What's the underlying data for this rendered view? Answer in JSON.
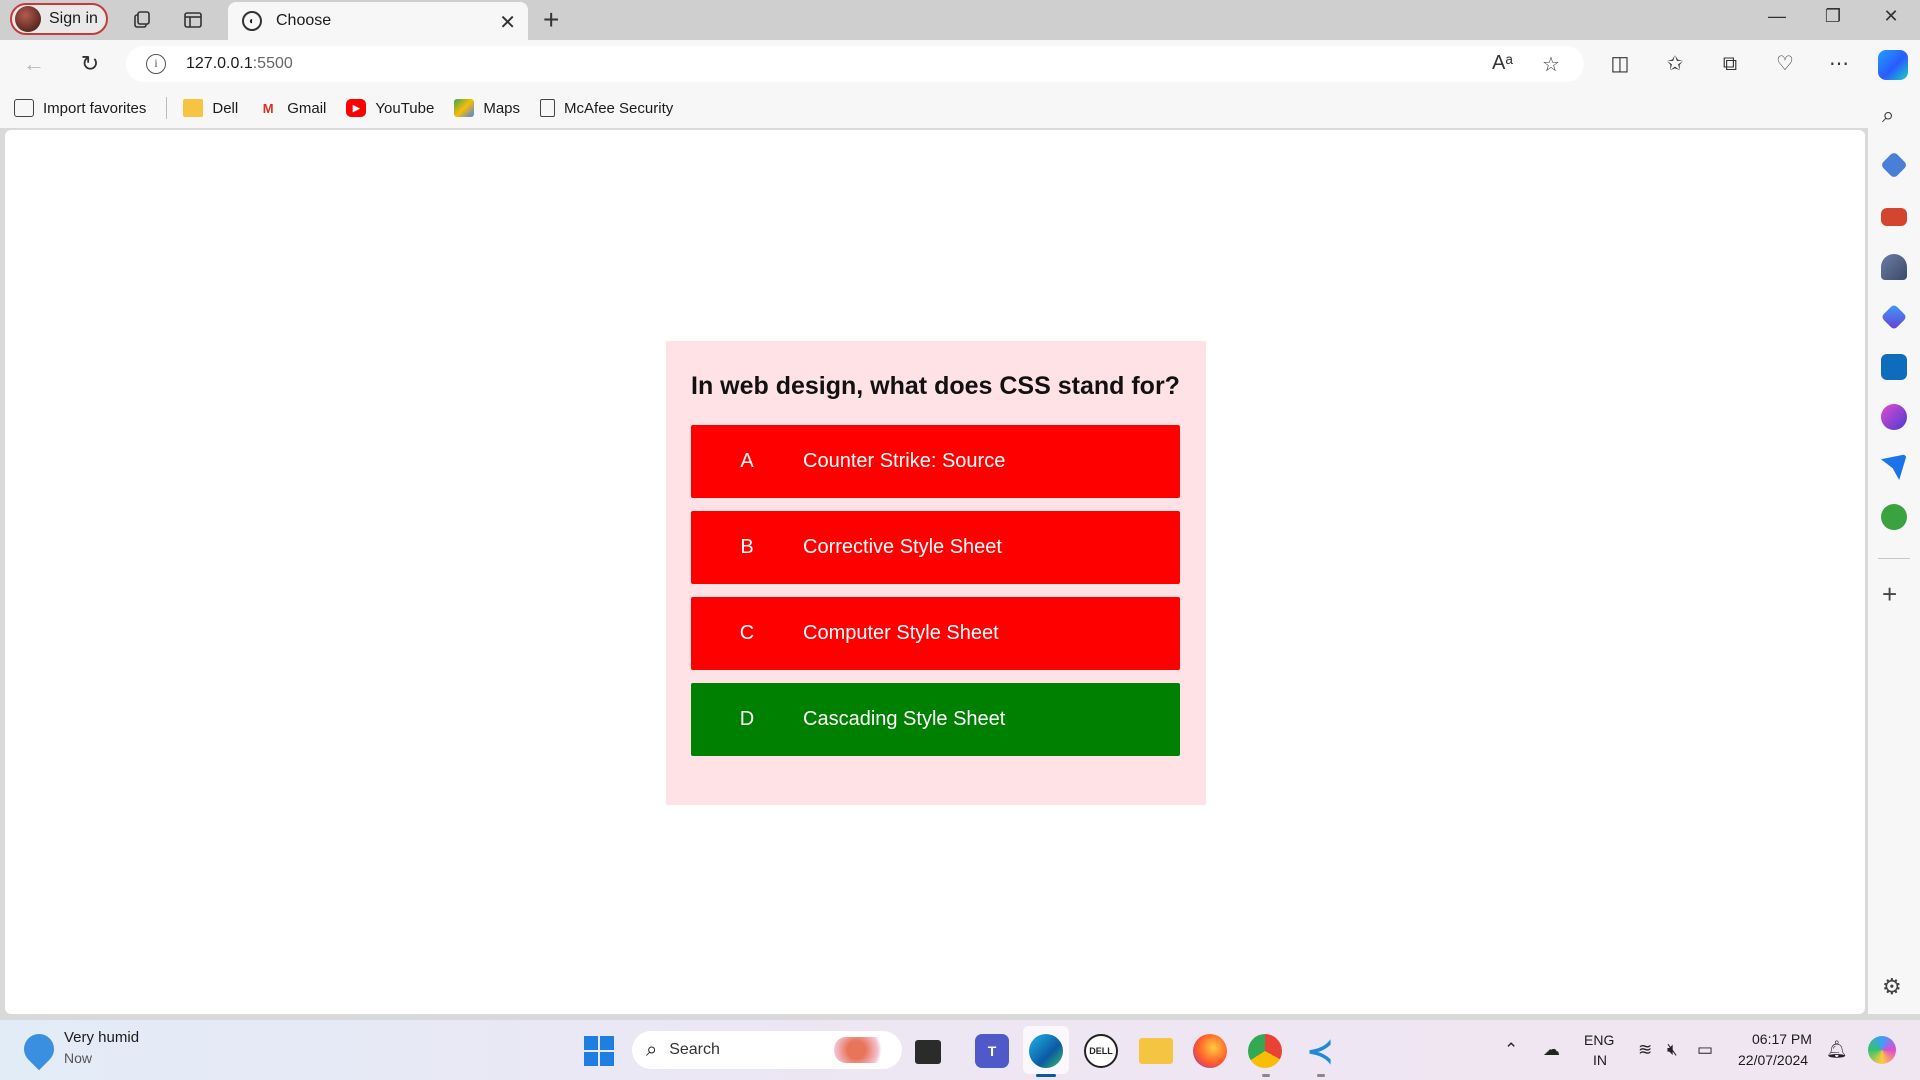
{
  "browser": {
    "signin_label": "Sign in",
    "tab_title": "Choose",
    "url_host": "127.0.0.1",
    "url_port": ":5500"
  },
  "favorites": [
    {
      "label": "Import favorites",
      "icon": "import-icon"
    },
    {
      "label": "Dell",
      "icon": "folder-icon"
    },
    {
      "label": "Gmail",
      "icon": "gmail-icon"
    },
    {
      "label": "YouTube",
      "icon": "youtube-icon"
    },
    {
      "label": "Maps",
      "icon": "maps-icon"
    },
    {
      "label": "McAfee Security",
      "icon": "page-icon"
    }
  ],
  "quiz": {
    "question": "In web design, what does CSS stand for?",
    "options": [
      {
        "letter": "A",
        "text": "Counter Strike: Source",
        "color": "#ff0000"
      },
      {
        "letter": "B",
        "text": "Corrective Style Sheet",
        "color": "#ff0000"
      },
      {
        "letter": "C",
        "text": "Computer Style Sheet",
        "color": "#ff0000"
      },
      {
        "letter": "D",
        "text": "Cascading Style Sheet",
        "color": "#008000"
      }
    ],
    "panel_color": "#ffe2e6"
  },
  "taskbar": {
    "weather_title": "Very humid",
    "weather_sub": "Now",
    "search_label": "Search",
    "lang_top": "ENG",
    "lang_bottom": "IN",
    "time": "06:17 PM",
    "date": "22/07/2024"
  }
}
